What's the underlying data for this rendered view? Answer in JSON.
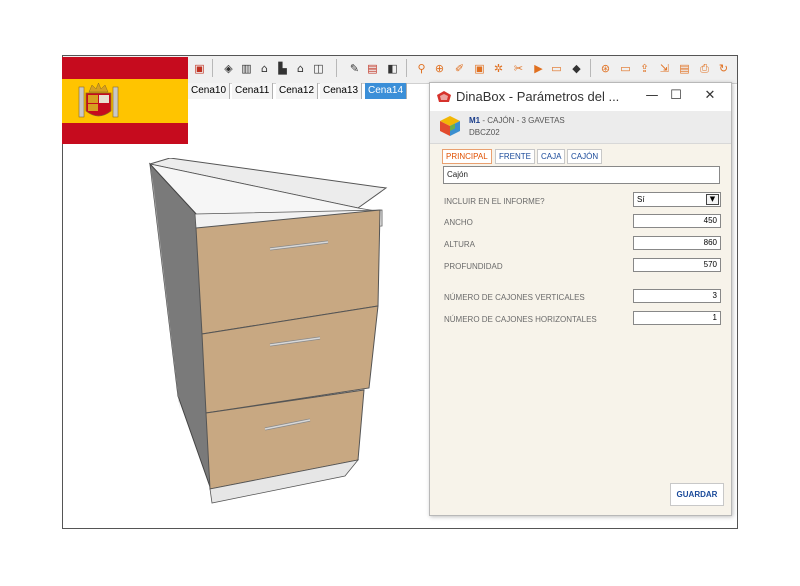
{
  "colors": {
    "flag_red": "#c60b1e",
    "flag_yellow": "#ffc400",
    "active_scene": "#3b8fd8",
    "dialog_body": "#f7f3ea",
    "tab_active": "#e05000",
    "link_blue": "#1a4a9a"
  },
  "toolbar": {
    "icons": [
      "component-icon",
      "cube-icon",
      "book-icon",
      "home-icon",
      "factory-icon",
      "house-icon",
      "layers-icon",
      "dinabox-icon",
      "settings-icon",
      "render-icon",
      "search-icon",
      "zoom-icon",
      "edit-icon",
      "select-icon",
      "gear-icon",
      "cut-icon",
      "play-icon",
      "window-icon",
      "color-cube-icon",
      "badge-90-icon",
      "monitor-icon",
      "upload-icon",
      "export-icon",
      "document-icon",
      "print-icon",
      "refresh-icon",
      "tag-icon"
    ]
  },
  "scenes": {
    "tabs": [
      "Cena10",
      "Cena11",
      "Cena12",
      "Cena13",
      "Cena14"
    ],
    "active": "Cena14"
  },
  "dialog": {
    "title": "DinaBox - Parámetros del ...",
    "minimize_glyph": "—",
    "maximize_glyph": "☐",
    "close_glyph": "✕",
    "module_code": "M1",
    "module_desc": "- CAJÓN - 3 GAVETAS",
    "module_sub": "DBCZ02",
    "tabs": [
      "PRINCIPAL",
      "FRENTE",
      "CAJA",
      "CAJÓN"
    ],
    "active_tab": "PRINCIPAL",
    "name_value": "Cajón",
    "params": {
      "informe": {
        "label": "INCLUIR EN EL INFORME?",
        "value": "Sí"
      },
      "ancho": {
        "label": "ANCHO",
        "value": "450"
      },
      "altura": {
        "label": "ALTURA",
        "value": "860"
      },
      "profundidad": {
        "label": "PROFUNDIDAD",
        "value": "570"
      },
      "cajones_v": {
        "label": "NÚMERO DE CAJONES VERTICALES",
        "value": "3"
      },
      "cajones_h": {
        "label": "NÚMERO DE CAJONES HORIZONTALES",
        "value": "1"
      }
    },
    "save_label": "GUARDAR"
  }
}
